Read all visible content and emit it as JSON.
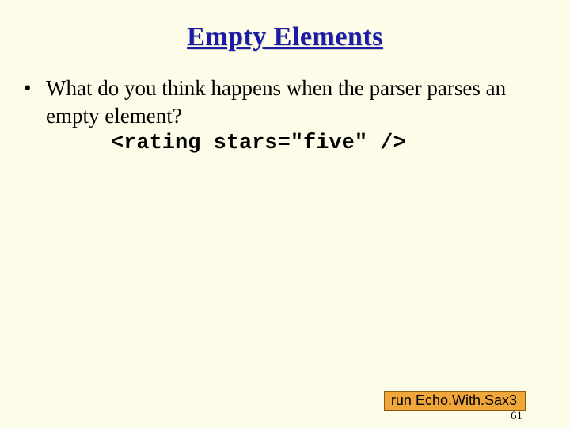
{
  "title": "Empty Elements",
  "bullet": {
    "marker": "•",
    "text": "What do you think happens when the parser parses an empty element?"
  },
  "code": "<rating stars=\"five\" />",
  "run_label": "run Echo.With.Sax3",
  "page_number": "61"
}
